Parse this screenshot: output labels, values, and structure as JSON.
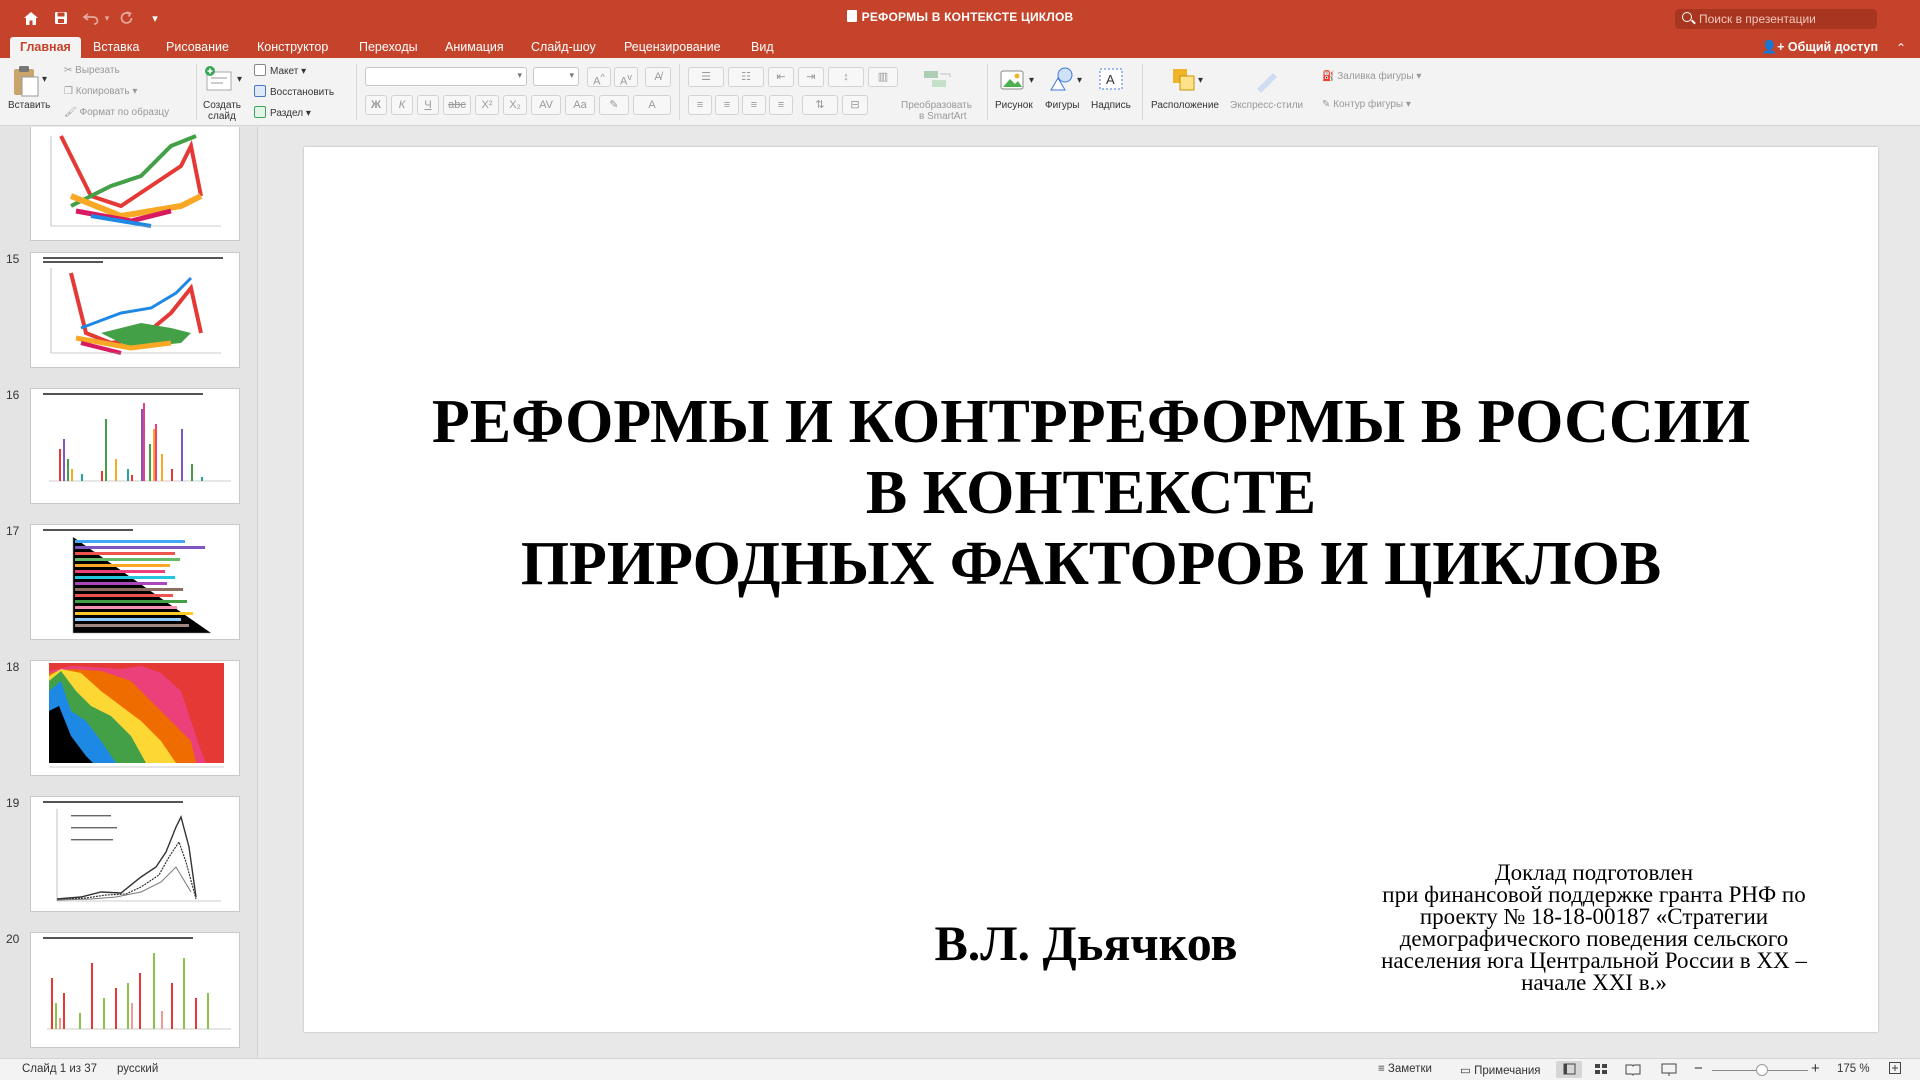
{
  "window": {
    "doc_title": "РЕФОРМЫ В КОНТЕКСТЕ ЦИКЛОВ",
    "search_placeholder": "Поиск в презентации"
  },
  "tabs": [
    {
      "label": "Главная",
      "active": true
    },
    {
      "label": "Вставка"
    },
    {
      "label": "Рисование"
    },
    {
      "label": "Конструктор"
    },
    {
      "label": "Переходы"
    },
    {
      "label": "Анимация"
    },
    {
      "label": "Слайд-шоу"
    },
    {
      "label": "Рецензирование"
    },
    {
      "label": "Вид"
    }
  ],
  "share_label": "Общий доступ",
  "ribbon": {
    "paste": "Вставить",
    "cut": "Вырезать",
    "copy": "Копировать",
    "format_painter": "Формат по образцу",
    "new_slide_1": "Создать",
    "new_slide_2": "слайд",
    "layout": "Макет",
    "reset": "Восстановить",
    "section": "Раздел",
    "smartart_1": "Преобразовать",
    "smartart_2": "в SmartArt",
    "picture": "Рисунок",
    "shapes": "Фигуры",
    "textbox": "Надпись",
    "arrange": "Расположение",
    "quick_styles": "Экспресс-стили",
    "shape_fill": "Заливка фигуры",
    "shape_outline": "Контур фигуры",
    "bold": "Ж",
    "italic": "К",
    "underline": "Ч",
    "strike": "abc",
    "superscript": "X²",
    "subscript": "X₂"
  },
  "thumbnails": [
    {
      "num": "",
      "kind": "3d-line-green"
    },
    {
      "num": "15",
      "kind": "3d-line-blue"
    },
    {
      "num": "16",
      "kind": "bars-vertical"
    },
    {
      "num": "17",
      "kind": "bars-horizontal"
    },
    {
      "num": "18",
      "kind": "stacked-area"
    },
    {
      "num": "19",
      "kind": "line-peak"
    },
    {
      "num": "20",
      "kind": "bars-rg"
    }
  ],
  "slide": {
    "title_lines": [
      "РЕФОРМЫ И КОНТРРЕФОРМЫ В РОССИИ",
      "В КОНТЕКСТЕ",
      "ПРИРОДНЫХ ФАКТОРОВ И ЦИКЛОВ"
    ],
    "author": "В.Л. Дьячков",
    "grant_lines": [
      "Доклад подготовлен",
      "при финансовой поддержке гранта РНФ по",
      "проекту № 18-18-00187 «Стратегии",
      "демографического поведения сельского",
      "населения юга Центральной России в XX –",
      "начале XXI в.»"
    ]
  },
  "status": {
    "slide_counter": "Слайд 1 из 37",
    "language": "русский",
    "notes": "Заметки",
    "comments": "Примечания",
    "zoom": "175 %"
  }
}
